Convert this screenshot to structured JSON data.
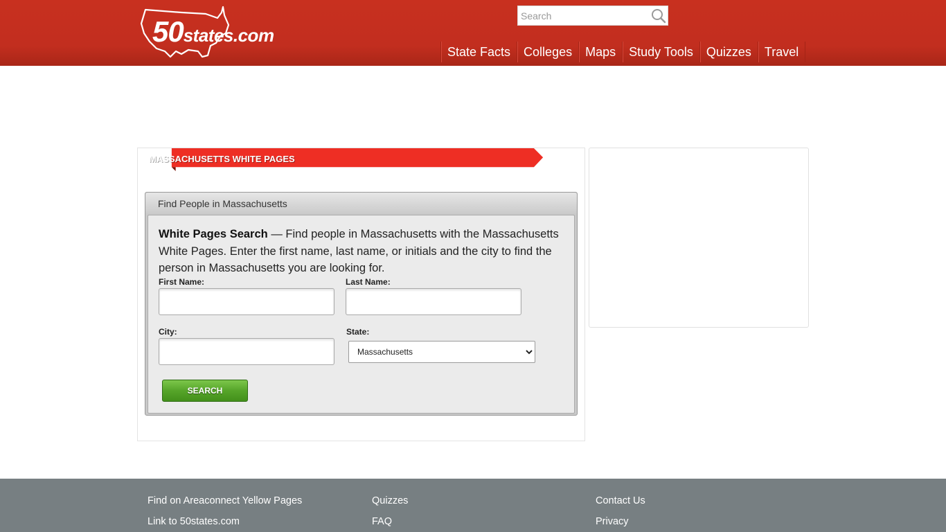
{
  "header": {
    "logo": {
      "big": "50",
      "small": "states.com"
    },
    "search": {
      "placeholder": "Search"
    },
    "nav": [
      "State Facts",
      "Colleges",
      "Maps",
      "Study Tools",
      "Quizzes",
      "Travel"
    ]
  },
  "main": {
    "ribbon_title": "MASSACHUSETTS WHITE PAGES",
    "card_title": "Find People in Massachusetts",
    "intro_bold": "White Pages Search",
    "intro_rest": " — Find people in Massachusetts with the Massachusetts White Pages. Enter the first name, last name, or initials and the city to find the person in Massachusetts you are looking for.",
    "form": {
      "first_name_label": "First Name:",
      "last_name_label": "Last Name:",
      "city_label": "City:",
      "state_label": "State:",
      "state_value": "Massachusetts",
      "submit_label": "SEARCH"
    }
  },
  "footer": {
    "col1": [
      "Find on Areaconnect Yellow Pages",
      "Link to 50states.com"
    ],
    "col2": [
      "Quizzes",
      "FAQ"
    ],
    "col3": [
      "Contact Us",
      "Privacy"
    ]
  },
  "colors": {
    "header_red": "#c22e1f",
    "ribbon_red": "#ee2e24",
    "button_green": "#56a52a",
    "footer_gray": "#777f82"
  }
}
